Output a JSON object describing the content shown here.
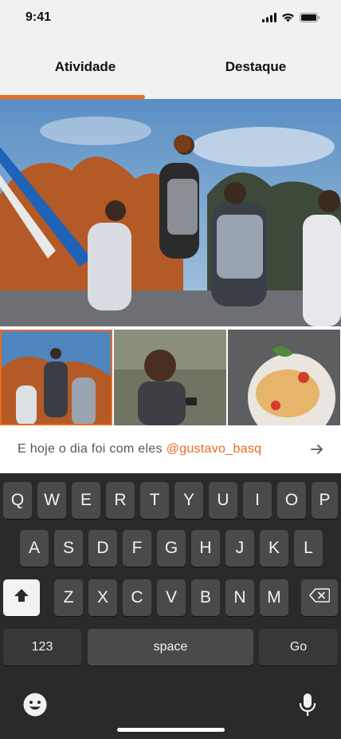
{
  "status_bar": {
    "time": "9:41",
    "icons": [
      "signal-icon",
      "wifi-icon",
      "battery-icon"
    ]
  },
  "tabs": [
    {
      "label": "Atividade",
      "active": true
    },
    {
      "label": "Destaque",
      "active": false
    }
  ],
  "colors": {
    "accent": "#ea6a1f",
    "tab_bg": "#f1f1f1",
    "keyboard_bg": "#2a2a2a",
    "key_bg": "#4a4a4a"
  },
  "caption": {
    "text": "E hoje o dia foi com eles ",
    "mention": "@gustavo_basq",
    "send_icon": "arrow-right-icon"
  },
  "thumbnails": [
    {
      "subject": "basketball",
      "selected": true
    },
    {
      "subject": "woman with phone",
      "selected": false
    },
    {
      "subject": "spaghetti",
      "selected": false
    }
  ],
  "keyboard": {
    "row1": [
      "Q",
      "W",
      "E",
      "R",
      "T",
      "Y",
      "U",
      "I",
      "O",
      "P"
    ],
    "row2": [
      "A",
      "S",
      "D",
      "F",
      "G",
      "H",
      "J",
      "K",
      "L"
    ],
    "row3": [
      "Z",
      "X",
      "C",
      "V",
      "B",
      "N",
      "M"
    ],
    "numbers_label": "123",
    "space_label": "space",
    "go_label": "Go",
    "icons": [
      "shift-icon",
      "backspace-icon",
      "emoji-icon",
      "microphone-icon"
    ]
  }
}
